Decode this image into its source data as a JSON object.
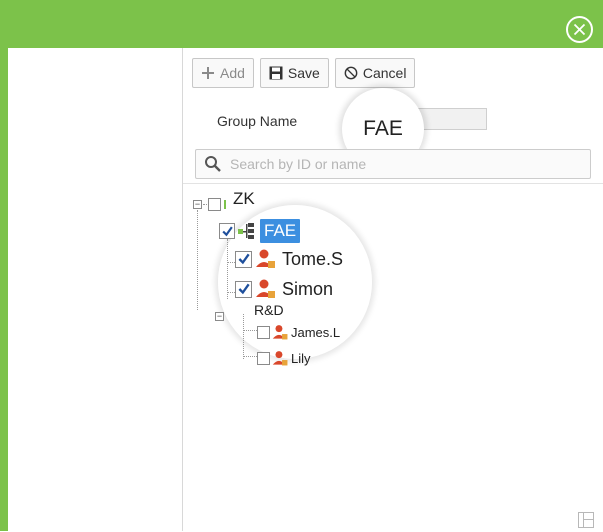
{
  "toolbar": {
    "add_label": "Add",
    "save_label": "Save",
    "cancel_label": "Cancel"
  },
  "form": {
    "group_name_label": "Group Name",
    "group_name_value": "FAE"
  },
  "search": {
    "placeholder": "Search by ID or name"
  },
  "tree": {
    "root": {
      "label": "ZK",
      "checked": false
    },
    "group_fae": {
      "label": "FAE",
      "checked": true,
      "selected": true
    },
    "users_fae": [
      {
        "label": "Tome.S",
        "checked": true
      },
      {
        "label": "Simon",
        "checked": true
      }
    ],
    "group_rd": {
      "label": "R&D",
      "checked": false
    },
    "users_rd": [
      {
        "label": "James.L",
        "checked": false
      },
      {
        "label": "Lily",
        "checked": false
      }
    ]
  },
  "colors": {
    "accent_green": "#7cc24a",
    "selection_blue": "#3c8fe0",
    "user_icon_orange": "#d9472b"
  }
}
